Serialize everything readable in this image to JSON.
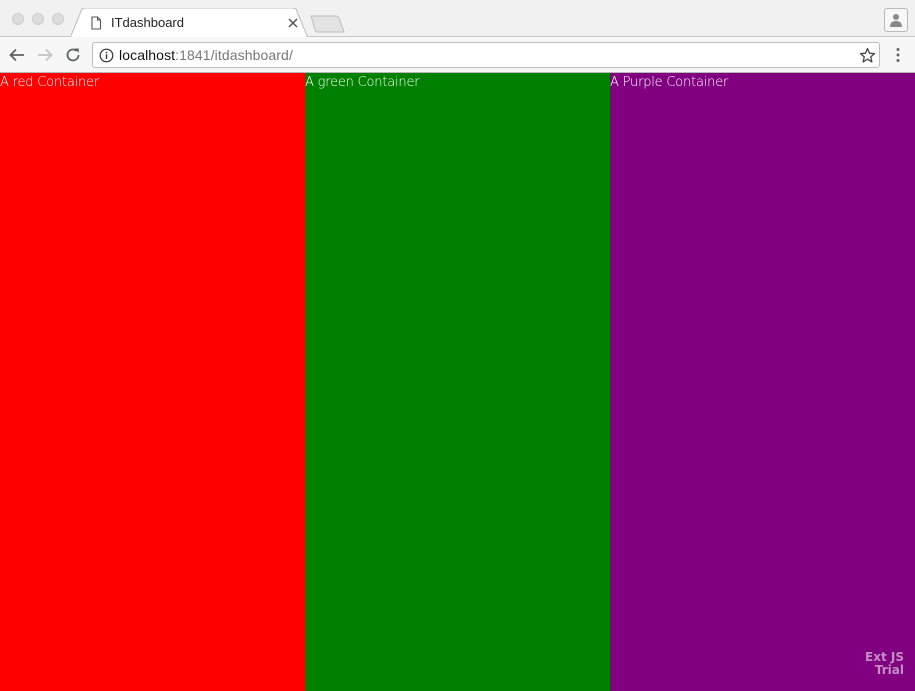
{
  "browser": {
    "tab": {
      "title": "ITdashboard",
      "icon": "document-icon",
      "close_icon": "close-icon"
    },
    "toolbar": {
      "back_icon": "arrow-left-icon",
      "forward_icon": "arrow-right-icon",
      "reload_icon": "reload-icon",
      "url_host": "localhost",
      "url_rest": ":1841/itdashboard/",
      "info_icon": "info-icon",
      "bookmark_icon": "star-icon",
      "menu_icon": "kebab-menu-icon"
    },
    "profile_icon": "person-icon"
  },
  "panels": [
    {
      "label": "A red Container",
      "color": "#ff0000"
    },
    {
      "label": "A green Container",
      "color": "#008000"
    },
    {
      "label": "A Purple Container",
      "color": "#800080"
    }
  ],
  "watermark": {
    "line1": "Ext JS",
    "line2": "Trial"
  }
}
